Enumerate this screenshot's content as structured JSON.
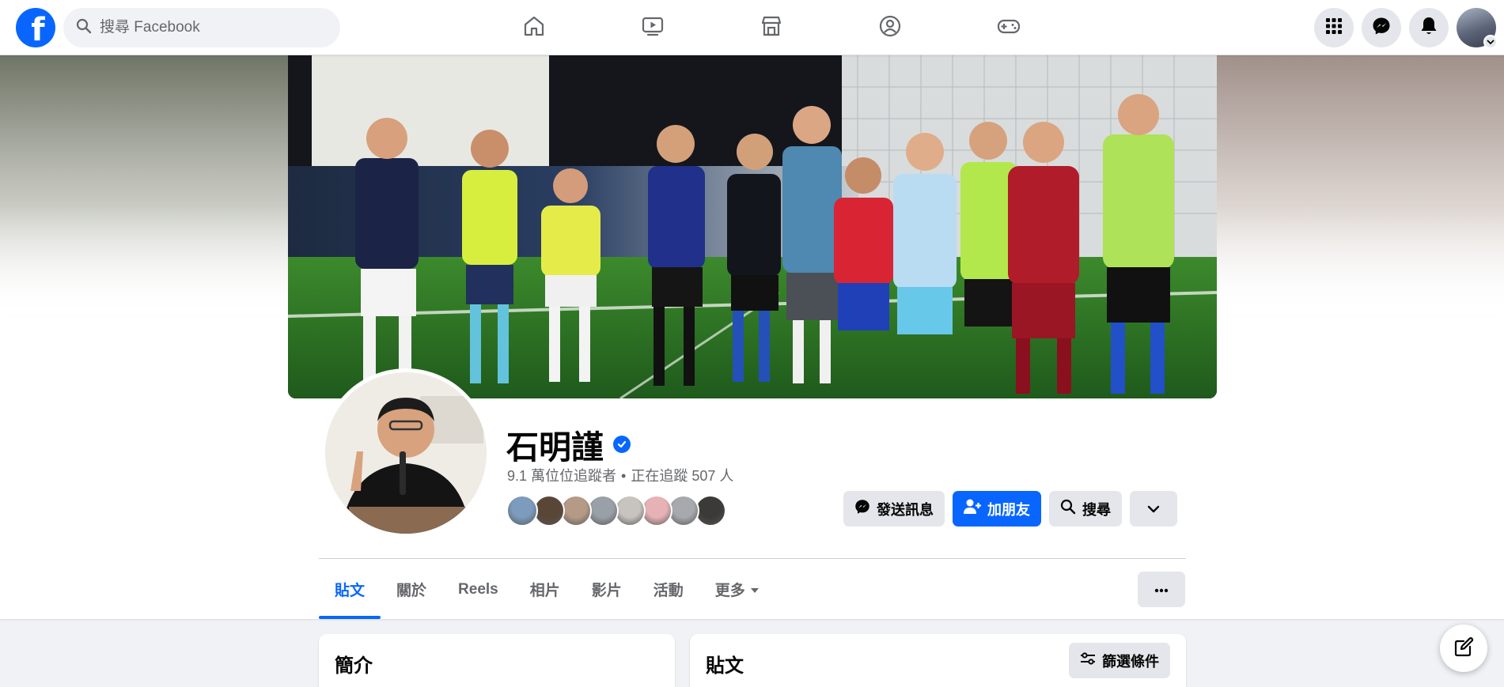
{
  "nav": {
    "logo": "f",
    "search_placeholder": "搜尋 Facebook",
    "icons": [
      "home-icon",
      "video-icon",
      "marketplace-icon",
      "groups-icon",
      "gaming-icon"
    ],
    "right_icons": [
      "menu-grid-icon",
      "messenger-icon",
      "notifications-icon",
      "account-avatar"
    ]
  },
  "profile": {
    "name": "石明謹",
    "verified": true,
    "followers_text": "9.1 萬位位追蹤者",
    "separator": "•",
    "following_text": "正在追蹤 507 人",
    "friend_avatar_colors": [
      "#7c9bbd",
      "#5a4636",
      "#b59a86",
      "#9aa0a8",
      "#c7c3be",
      "#e7b2b6",
      "#a6a9ad",
      "#3b3a38"
    ]
  },
  "actions": {
    "message": "發送訊息",
    "add_friend": "加朋友",
    "search": "搜尋"
  },
  "tabs": [
    {
      "label": "貼文",
      "active": true
    },
    {
      "label": "關於",
      "active": false
    },
    {
      "label": "Reels",
      "active": false
    },
    {
      "label": "相片",
      "active": false
    },
    {
      "label": "影片",
      "active": false
    },
    {
      "label": "活動",
      "active": false
    },
    {
      "label": "更多",
      "active": false
    }
  ],
  "intro": {
    "title": "簡介"
  },
  "posts": {
    "title": "貼文",
    "filter_label": "篩選條件"
  },
  "colors": {
    "brand": "#0866ff",
    "grey_button": "#e4e6eb",
    "secondary_text": "#65676b"
  }
}
